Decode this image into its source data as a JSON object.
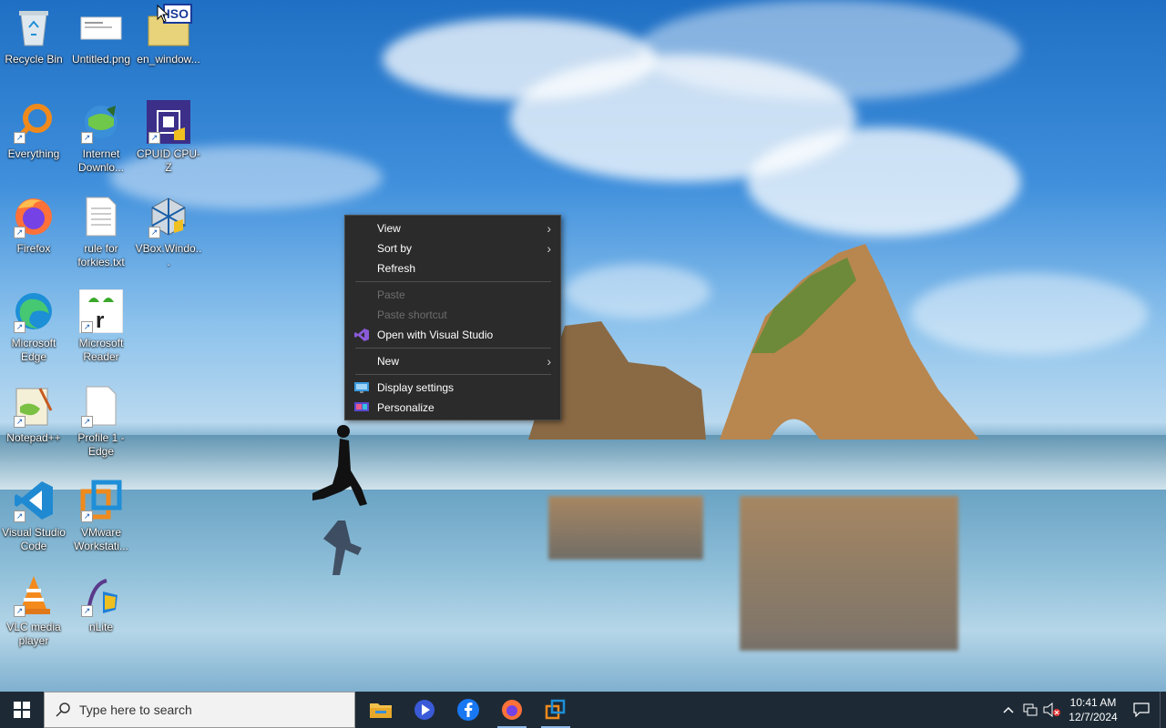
{
  "desktop": {
    "icons": [
      {
        "label": "Recycle Bin"
      },
      {
        "label": "Untitled.png"
      },
      {
        "label": "en_window..."
      },
      {
        "label": "Everything"
      },
      {
        "label": "Internet Downlo..."
      },
      {
        "label": "CPUID CPU-Z"
      },
      {
        "label": "Firefox"
      },
      {
        "label": "rule for forkies.txt"
      },
      {
        "label": "VBox.Windo..."
      },
      {
        "label": "Microsoft Edge"
      },
      {
        "label": "Microsoft Reader"
      },
      {
        "label": "Notepad++"
      },
      {
        "label": "Profile 1 - Edge"
      },
      {
        "label": "Visual Studio Code"
      },
      {
        "label": "VMware Workstati..."
      },
      {
        "label": "VLC media player"
      },
      {
        "label": "nLite"
      }
    ],
    "iso_badge": "ISO"
  },
  "context_menu": {
    "view": "View",
    "sort_by": "Sort by",
    "refresh": "Refresh",
    "paste": "Paste",
    "paste_shortcut": "Paste shortcut",
    "open_vs": "Open with Visual Studio",
    "new": "New",
    "display_settings": "Display settings",
    "personalize": "Personalize"
  },
  "taskbar": {
    "search_placeholder": "Type here to search",
    "time": "10:41 AM",
    "date": "12/7/2024"
  }
}
